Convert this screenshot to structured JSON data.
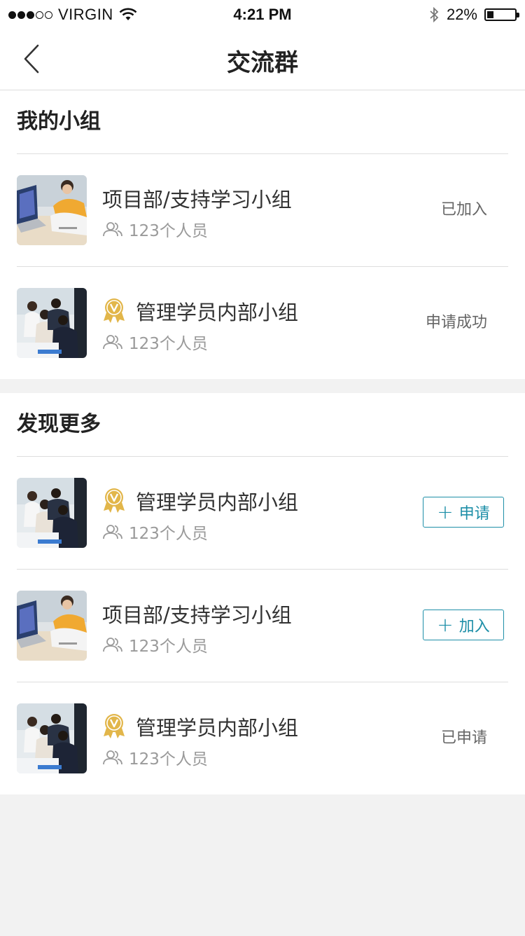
{
  "status_bar": {
    "carrier": "VIRGIN",
    "time": "4:21 PM",
    "battery": "22%",
    "battery_level": 0.22
  },
  "nav": {
    "title": "交流群"
  },
  "my_groups": {
    "title": "我的小组",
    "items": [
      {
        "name": "项目部/支持学习小组",
        "members": "123个人员",
        "status": "已加入",
        "badge": false,
        "photo": "laptop-meeting"
      },
      {
        "name": "管理学员内部小组",
        "members": "123个人员",
        "status": "申请成功",
        "badge": true,
        "photo": "team-meeting"
      }
    ]
  },
  "discover": {
    "title": "发现更多",
    "items": [
      {
        "name": "管理学员内部小组",
        "members": "123个人员",
        "button": "申请",
        "badge": true,
        "photo": "team-meeting"
      },
      {
        "name": "项目部/支持学习小组",
        "members": "123个人员",
        "button": "加入",
        "badge": false,
        "photo": "laptop-meeting"
      },
      {
        "name": "管理学员内部小组",
        "members": "123个人员",
        "status": "已申请",
        "badge": true,
        "photo": "team-meeting"
      }
    ]
  },
  "colors": {
    "accent": "#1e8fa8",
    "badge_gold": "#e2b64a",
    "muted_text": "#9a9a9a",
    "background": "#f2f2f2"
  },
  "icons": {
    "back": "chevron-left-icon",
    "members": "people-icon",
    "badge": "vip-medal-icon",
    "add": "plus-icon"
  }
}
